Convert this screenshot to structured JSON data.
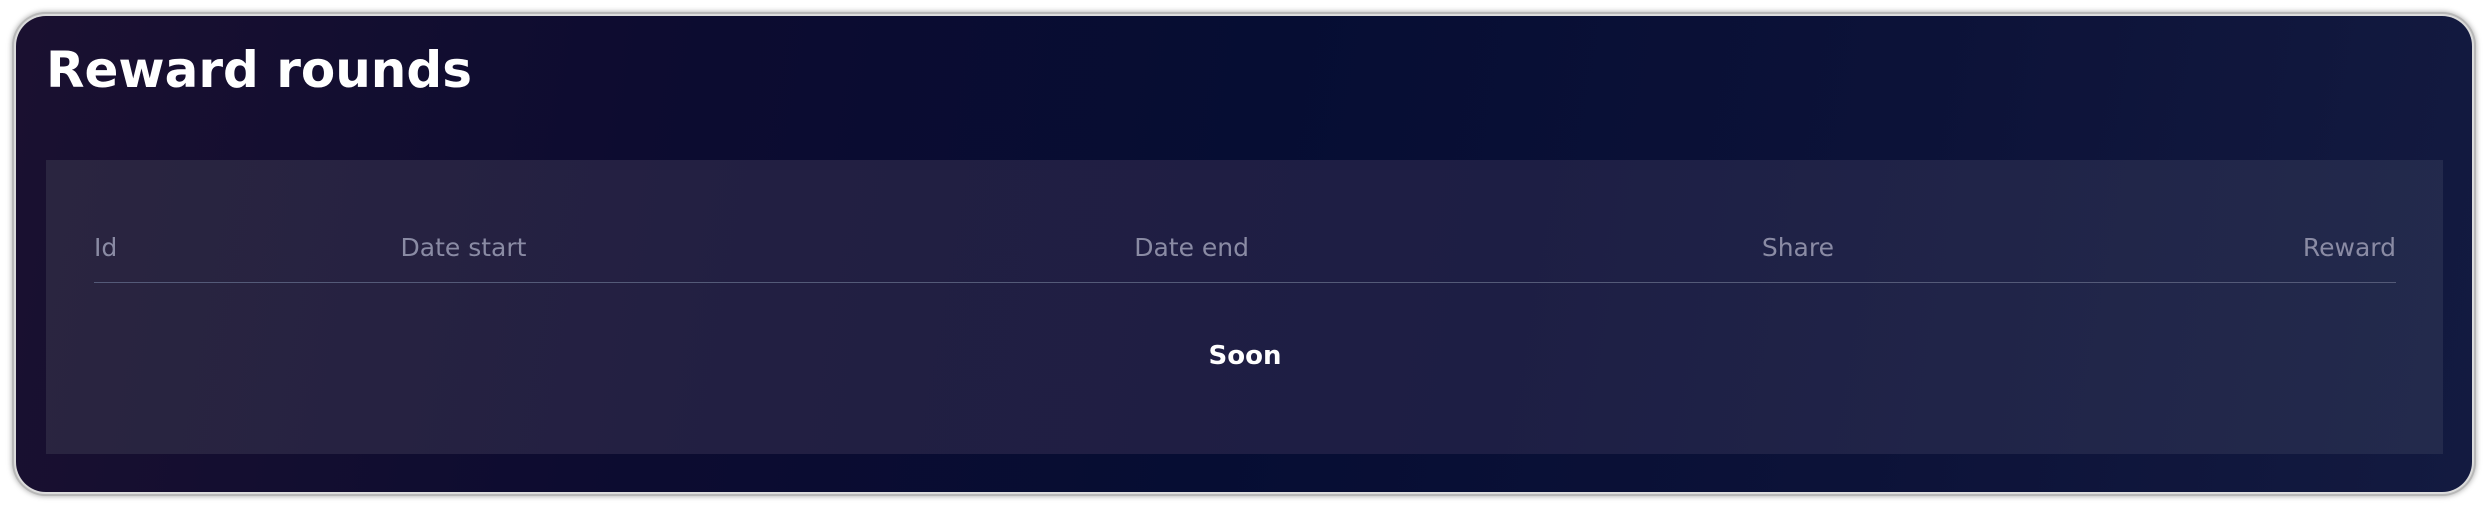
{
  "panel": {
    "title": "Reward rounds"
  },
  "table": {
    "columns": [
      "Id",
      "Date start",
      "Date end",
      "Share",
      "Reward"
    ],
    "empty_message": "Soon"
  }
}
